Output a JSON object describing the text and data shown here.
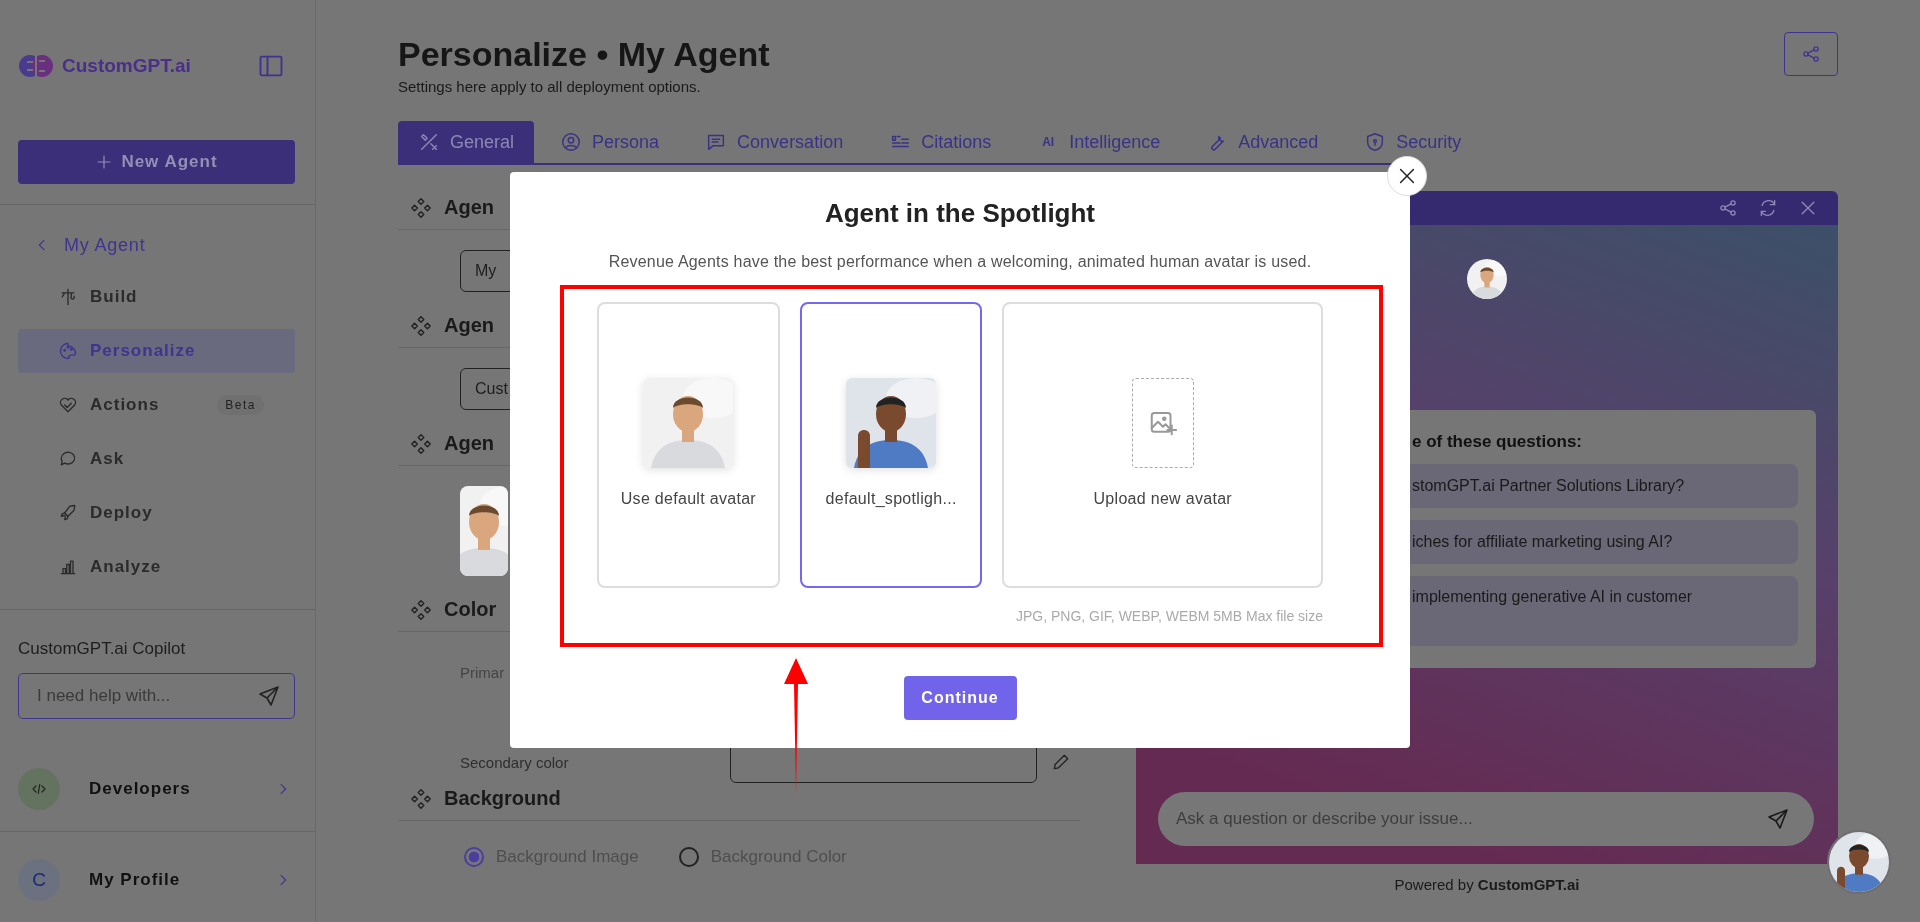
{
  "sidebar": {
    "logo": "CustomGPT.ai",
    "new_agent": "New Agent",
    "back": "My Agent",
    "items": [
      {
        "label": "Build",
        "selected": false
      },
      {
        "label": "Personalize",
        "selected": true
      },
      {
        "label": "Actions",
        "selected": false,
        "badge": "Beta"
      },
      {
        "label": "Ask",
        "selected": false
      },
      {
        "label": "Deploy",
        "selected": false
      },
      {
        "label": "Analyze",
        "selected": false
      }
    ],
    "copilot": {
      "title": "CustomGPT.ai Copilot",
      "placeholder": "I need help with..."
    },
    "developers": "Developers",
    "profile": {
      "initial": "C",
      "label": "My Profile"
    }
  },
  "header": {
    "title": "Personalize • My Agent",
    "subtitle": "Settings here apply to all deployment options."
  },
  "tabs": [
    {
      "label": "General",
      "selected": true
    },
    {
      "label": "Persona",
      "selected": false
    },
    {
      "label": "Conversation",
      "selected": false
    },
    {
      "label": "Citations",
      "selected": false
    },
    {
      "label": "Intelligence",
      "icon_text": "AI",
      "selected": false
    },
    {
      "label": "Advanced",
      "selected": false
    },
    {
      "label": "Security",
      "selected": false
    }
  ],
  "form": {
    "sections": [
      {
        "kind": "field",
        "heading": "Agen",
        "value": "My"
      },
      {
        "kind": "field",
        "heading": "Agen",
        "value": "Cust"
      },
      {
        "kind": "avatar",
        "heading": "Agen"
      },
      {
        "kind": "colors",
        "heading": "Color",
        "primary": "Primar",
        "secondary": "Secondary color"
      },
      {
        "kind": "radios",
        "heading": "Background",
        "options": [
          {
            "label": "Background Image",
            "selected": true
          },
          {
            "label": "Background Color",
            "selected": false
          }
        ]
      }
    ]
  },
  "preview": {
    "prompt": "e of these questions:",
    "questions": [
      "stomGPT.ai Partner Solutions Library?",
      "iches for affiliate marketing using AI?",
      "implementing generative AI in customer"
    ],
    "placeholder": "Ask a question or describe your issue...",
    "powered_by": "Powered by **CustomGPT.ai**"
  },
  "modal": {
    "title": "Agent in the Spotlight",
    "description": "Revenue Agents have the best performance when a welcoming, animated human avatar is used.",
    "options": [
      {
        "kind": "avatar",
        "label": "Use default avatar",
        "selected": false
      },
      {
        "kind": "avatar",
        "label": "default_spotligh...",
        "selected": true
      },
      {
        "kind": "upload",
        "label": "Upload new avatar",
        "selected": false
      }
    ],
    "hint": "JPG, PNG, GIF, WEBP, WEBM 5MB Max file size",
    "button": "Continue"
  }
}
